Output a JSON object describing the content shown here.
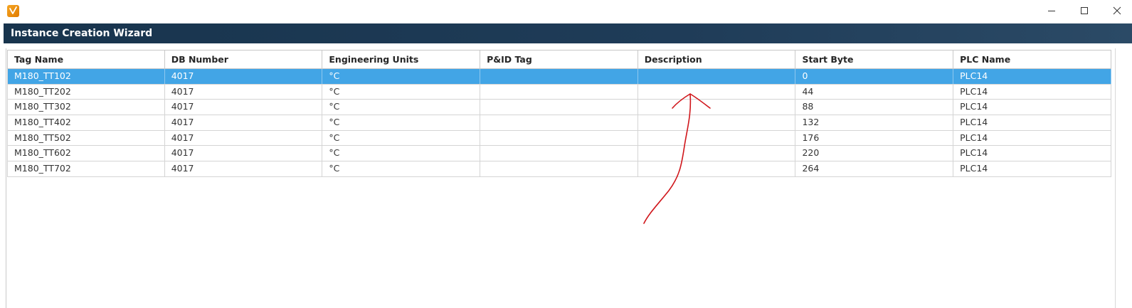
{
  "window": {
    "title": "",
    "controls": {
      "minimize_icon": "minimize-icon",
      "maximize_icon": "maximize-icon",
      "close_icon": "close-icon"
    }
  },
  "wizard": {
    "title": "Instance Creation Wizard"
  },
  "table": {
    "columns": [
      "Tag Name",
      "DB Number",
      "Engineering Units",
      "P&ID Tag",
      "Description",
      "Start Byte",
      "PLC Name"
    ],
    "rows": [
      {
        "tag": "M180_TT102",
        "db": "4017",
        "units": "°C",
        "pid": "",
        "desc": "",
        "start": "0",
        "plc": "PLC14"
      },
      {
        "tag": "M180_TT202",
        "db": "4017",
        "units": "°C",
        "pid": "",
        "desc": "",
        "start": "44",
        "plc": "PLC14"
      },
      {
        "tag": "M180_TT302",
        "db": "4017",
        "units": "°C",
        "pid": "",
        "desc": "",
        "start": "88",
        "plc": "PLC14"
      },
      {
        "tag": "M180_TT402",
        "db": "4017",
        "units": "°C",
        "pid": "",
        "desc": "",
        "start": "132",
        "plc": "PLC14"
      },
      {
        "tag": "M180_TT502",
        "db": "4017",
        "units": "°C",
        "pid": "",
        "desc": "",
        "start": "176",
        "plc": "PLC14"
      },
      {
        "tag": "M180_TT602",
        "db": "4017",
        "units": "°C",
        "pid": "",
        "desc": "",
        "start": "220",
        "plc": "PLC14"
      },
      {
        "tag": "M180_TT702",
        "db": "4017",
        "units": "°C",
        "pid": "",
        "desc": "",
        "start": "264",
        "plc": "PLC14"
      }
    ],
    "selected_row": 0
  },
  "colors": {
    "header_bar": "#1f3c58",
    "selected_row": "#42a5e6",
    "annotation": "#d0161b"
  }
}
